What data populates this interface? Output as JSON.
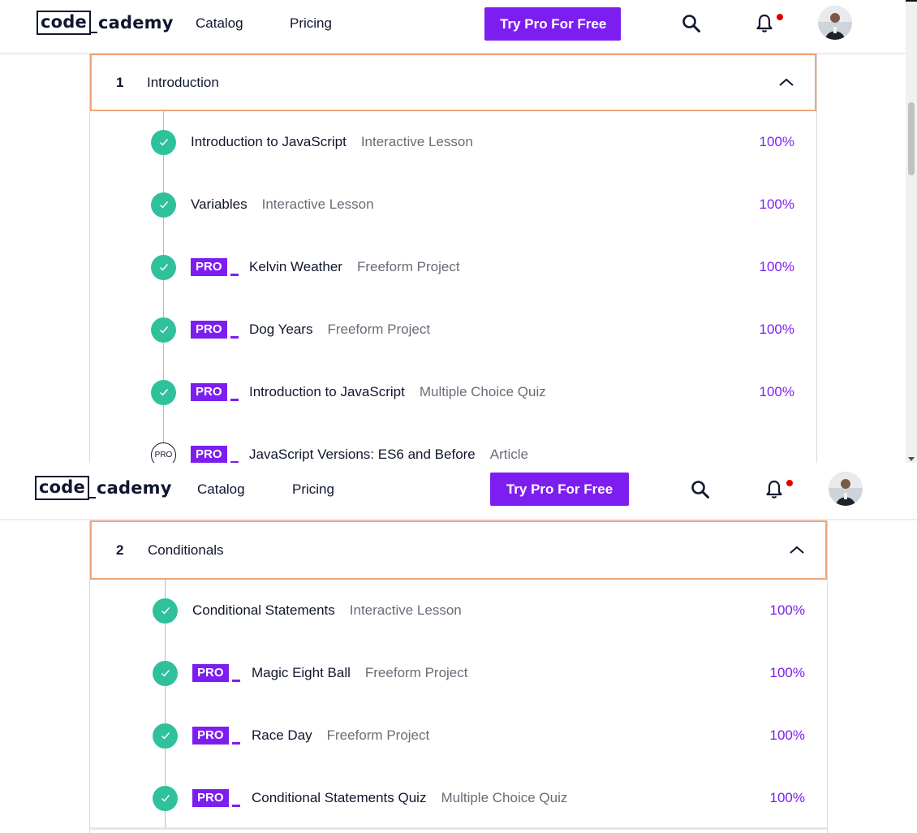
{
  "nav": {
    "logo_code": "code",
    "logo_rest": "cademy",
    "catalog": "Catalog",
    "pricing": "Pricing",
    "cta": "Try Pro For Free",
    "search_icon": "search-icon",
    "bell_icon": "bell-icon",
    "notification_dot_color": "#e00000"
  },
  "colors": {
    "accent": "#7d1ef0",
    "complete": "#2fc19b",
    "module_border": "#f0a67a",
    "text": "#10162f",
    "muted": "#6b6b78"
  },
  "pro_label": "PRO",
  "module1": {
    "number": "1",
    "title": "Introduction",
    "items": [
      {
        "title": "Introduction to JavaScript",
        "type": "Interactive Lesson",
        "progress": "100%",
        "pro": false,
        "status": "complete"
      },
      {
        "title": "Variables",
        "type": "Interactive Lesson",
        "progress": "100%",
        "pro": false,
        "status": "complete"
      },
      {
        "title": "Kelvin Weather",
        "type": "Freeform Project",
        "progress": "100%",
        "pro": true,
        "status": "complete"
      },
      {
        "title": "Dog Years",
        "type": "Freeform Project",
        "progress": "100%",
        "pro": true,
        "status": "complete"
      },
      {
        "title": "Introduction to JavaScript",
        "type": "Multiple Choice Quiz",
        "progress": "100%",
        "pro": true,
        "status": "complete"
      },
      {
        "title": "JavaScript Versions: ES6 and Before",
        "type": "Article",
        "progress": "",
        "pro": true,
        "status": "pro",
        "status_label": "PRO"
      }
    ]
  },
  "module2": {
    "number": "2",
    "title": "Conditionals",
    "items": [
      {
        "title": "Conditional Statements",
        "type": "Interactive Lesson",
        "progress": "100%",
        "pro": false,
        "status": "complete"
      },
      {
        "title": "Magic Eight Ball",
        "type": "Freeform Project",
        "progress": "100%",
        "pro": true,
        "status": "complete"
      },
      {
        "title": "Race Day",
        "type": "Freeform Project",
        "progress": "100%",
        "pro": true,
        "status": "complete"
      },
      {
        "title": "Conditional Statements Quiz",
        "type": "Multiple Choice Quiz",
        "progress": "100%",
        "pro": true,
        "status": "complete"
      }
    ]
  }
}
